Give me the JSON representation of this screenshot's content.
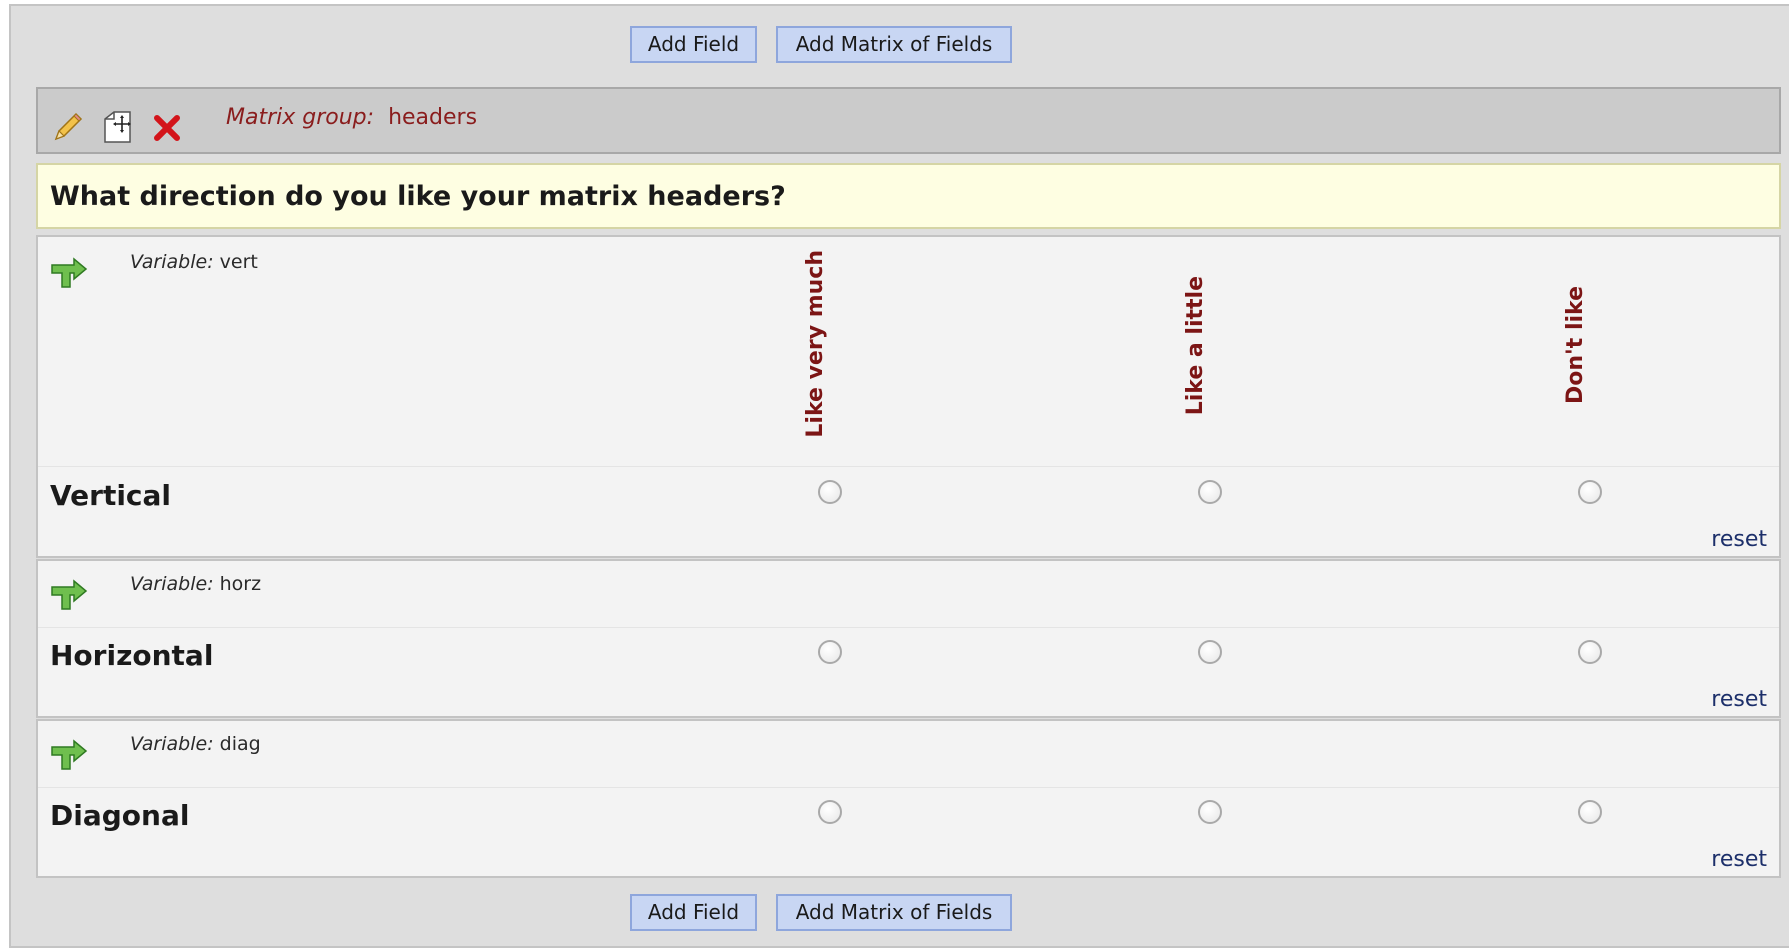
{
  "toolbar": {
    "add_field": "Add Field",
    "add_matrix": "Add Matrix of Fields"
  },
  "matrix_group": {
    "label": "Matrix group:",
    "name": "headers",
    "icons": [
      "pencil-icon",
      "move-icon",
      "delete-icon"
    ]
  },
  "question": "What direction do you like your matrix headers?",
  "columns": [
    "Like very much",
    "Like a little",
    "Don't like"
  ],
  "rows": [
    {
      "variable_label": "Variable:",
      "variable": "vert",
      "label": "Vertical",
      "reset": "reset"
    },
    {
      "variable_label": "Variable:",
      "variable": "horz",
      "label": "Horizontal",
      "reset": "reset"
    },
    {
      "variable_label": "Variable:",
      "variable": "diag",
      "label": "Diagonal",
      "reset": "reset"
    }
  ],
  "colors": {
    "header_text": "#7c1515",
    "button_bg": "#c8d6f3",
    "question_bg": "#fefee2"
  }
}
